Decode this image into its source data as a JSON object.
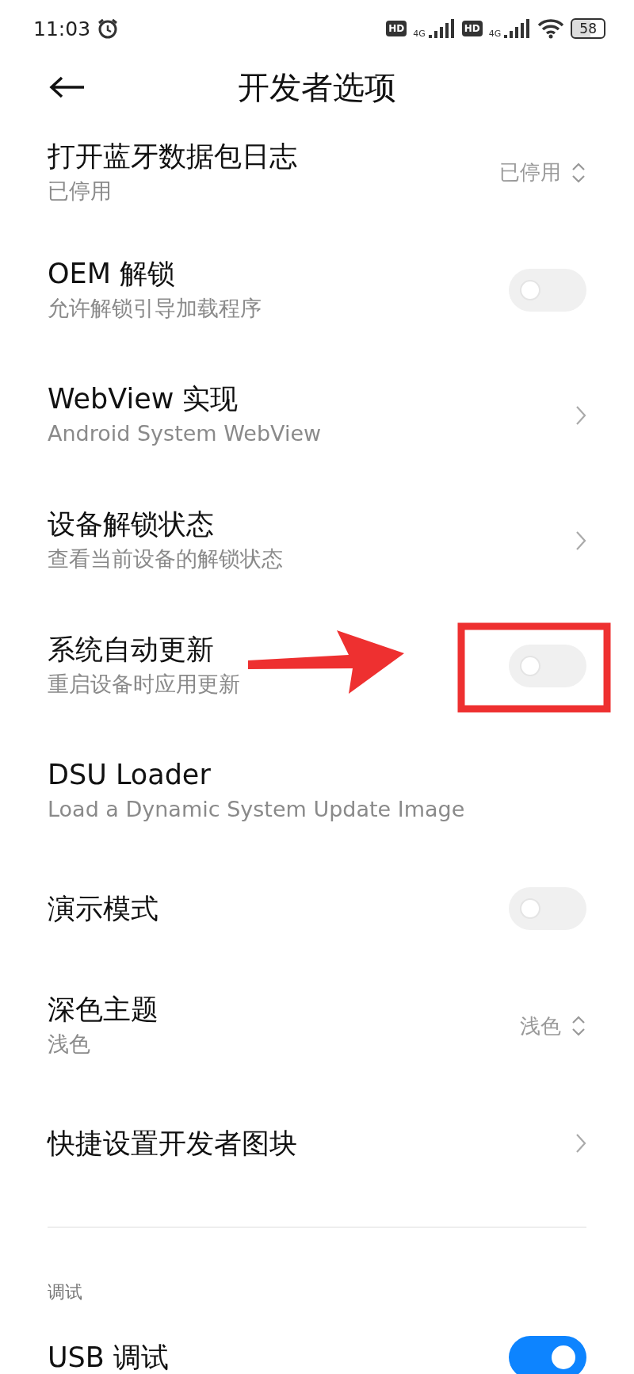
{
  "status_bar": {
    "time": "11:03",
    "sims": [
      {
        "hd": "HD",
        "network": "4G"
      },
      {
        "hd": "HD",
        "network": "4G"
      }
    ],
    "battery": "58"
  },
  "header": {
    "title": "开发者选项"
  },
  "rows": [
    {
      "kind": "select",
      "title": "打开蓝牙数据包日志",
      "subtitle": "已停用",
      "value": "已停用"
    },
    {
      "kind": "toggle",
      "title": "OEM 解锁",
      "subtitle": "允许解锁引导加载程序",
      "on": false
    },
    {
      "kind": "link",
      "title": "WebView 实现",
      "subtitle": "Android System WebView"
    },
    {
      "kind": "link",
      "title": "设备解锁状态",
      "subtitle": "查看当前设备的解锁状态"
    },
    {
      "kind": "toggle",
      "title": "系统自动更新",
      "subtitle": "重启设备时应用更新",
      "on": false,
      "highlighted": true
    },
    {
      "kind": "plain",
      "title": "DSU Loader",
      "subtitle": "Load a Dynamic System Update Image"
    },
    {
      "kind": "toggle",
      "title": "演示模式",
      "on": false
    },
    {
      "kind": "select",
      "title": "深色主题",
      "subtitle": "浅色",
      "value": "浅色"
    },
    {
      "kind": "link",
      "title": "快捷设置开发者图块"
    }
  ],
  "section": {
    "title": "调试",
    "rows": [
      {
        "kind": "toggle",
        "title": "USB 调试",
        "on": true
      }
    ]
  }
}
